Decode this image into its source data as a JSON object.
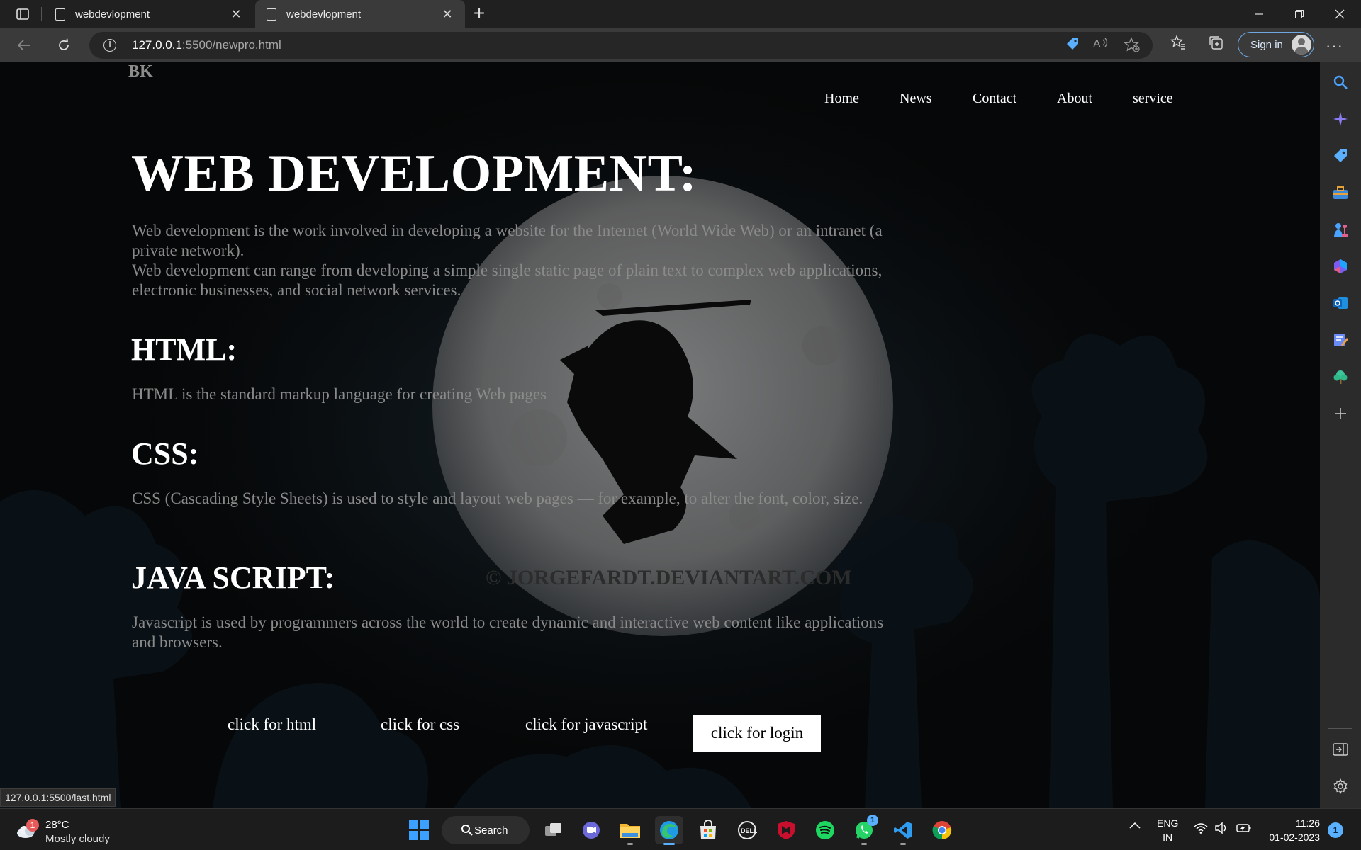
{
  "browser": {
    "tabs": [
      {
        "title": "webdevlopment",
        "active": false
      },
      {
        "title": "webdevlopment",
        "active": true
      }
    ],
    "url_host": "127.0.0.1",
    "url_path": ":5500/newpro.html",
    "signin_label": "Sign in",
    "status_url": "127.0.0.1:5500/last.html"
  },
  "site": {
    "logo": "BK",
    "nav": [
      "Home",
      "News",
      "Contact",
      "About",
      "service"
    ],
    "title": "WEB DEVELOPMENT:",
    "intro_1": "Web development is the work involved in developing a website for the Internet (World Wide Web) or an intranet (a private network).",
    "intro_2": "Web development can range from developing a simple single static page of plain text to complex web applications, electronic businesses, and social network services.",
    "sections": [
      {
        "heading": "HTML:",
        "text": "HTML is the standard markup language for creating Web pages"
      },
      {
        "heading": "CSS:",
        "text": "CSS (Cascading Style Sheets) is used to style and layout web pages — for example, to alter the font, color, size."
      },
      {
        "heading": "JAVA SCRIPT:",
        "text": "Javascript is used by programmers across the world to create dynamic and interactive web content like applications and browsers."
      }
    ],
    "buttons": [
      "click for html",
      "click for css",
      "click for javascript",
      "click for login"
    ],
    "watermark": "© JORGEFARDT.DEVIANTART.COM"
  },
  "taskbar": {
    "weather_badge": "1",
    "temperature": "28°C",
    "condition": "Mostly cloudy",
    "search_label": "Search",
    "whatsapp_badge": "1",
    "language": "ENG",
    "region": "IN",
    "time": "11:26",
    "date": "01-02-2023",
    "notification_count": "1"
  },
  "colors": {
    "accent": "#5ab0ff",
    "page_bg": "#060708",
    "moon": "#7a7a7a",
    "body_text": "#8a8a8a"
  }
}
